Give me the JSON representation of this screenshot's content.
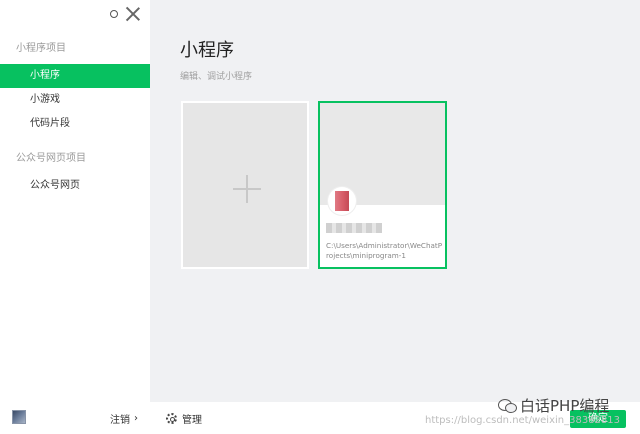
{
  "sidebar": {
    "section1_title": "小程序项目",
    "items": [
      {
        "label": "小程序"
      },
      {
        "label": "小游戏"
      },
      {
        "label": "代码片段"
      }
    ],
    "section2_title": "公众号网页项目",
    "items2": [
      {
        "label": "公众号网页"
      }
    ],
    "logout_label": "注销"
  },
  "main": {
    "title": "小程序",
    "subtitle": "编辑、调试小程序",
    "project": {
      "path": "C:\\Users\\Administrator\\WeChatProjects\\miniprogram-1"
    },
    "manage_label": "管理",
    "confirm_label": "确定"
  },
  "watermark": {
    "brand": "白话PHP编程",
    "url": "https://blog.csdn.net/weixin_38382813"
  },
  "colors": {
    "accent": "#07c160",
    "sidebar_bg": "#ffffff",
    "main_bg": "#f0f1f3"
  }
}
